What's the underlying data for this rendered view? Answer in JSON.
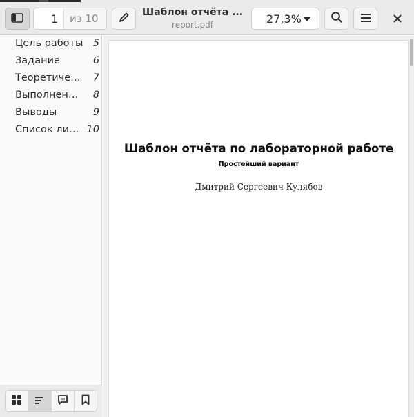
{
  "header": {
    "sidebar_toggle_icon": "sidebar-icon",
    "page_current": "1",
    "page_total": "из 10",
    "annotate_icon": "pencil-icon",
    "title": "Шаблон отчёта ...",
    "filename": "report.pdf",
    "zoom": "27,3%",
    "search_icon": "search-icon",
    "menu_icon": "hamburger-icon",
    "close_icon": "close-icon"
  },
  "sidebar": {
    "toc": [
      {
        "label": "Цель работы",
        "page": "5"
      },
      {
        "label": "Задание",
        "page": "6"
      },
      {
        "label": "Теоретичес...",
        "page": "7"
      },
      {
        "label": "Выполнение...",
        "page": "8"
      },
      {
        "label": "Выводы",
        "page": "9"
      },
      {
        "label": "Список лите...",
        "page": "10"
      }
    ],
    "modes": [
      "thumbnails-icon",
      "outline-icon",
      "annotations-icon",
      "bookmarks-icon"
    ],
    "active_mode": "outline"
  },
  "document": {
    "title": "Шаблон отчёта по лабораторной работе",
    "subtitle": "Простейший вариант",
    "author": "Дмитрий Сергеевич Кулябов"
  }
}
